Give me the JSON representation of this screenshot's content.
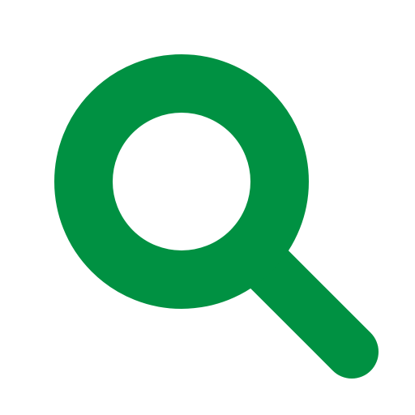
{
  "icon": {
    "name": "search-icon",
    "color": "#009142",
    "background": "#ffffff"
  }
}
